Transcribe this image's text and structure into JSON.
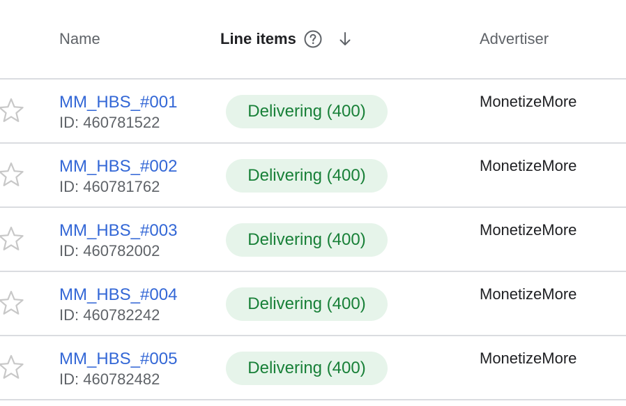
{
  "header": {
    "name_label": "Name",
    "line_items_label": "Line items",
    "advertiser_label": "Advertiser",
    "help_icon": "help-circle-icon",
    "sort_icon": "arrow-down-icon"
  },
  "colors": {
    "link": "#3367d6",
    "chip_bg": "#e6f4ea",
    "chip_text": "#188038",
    "divider": "#dadce0"
  },
  "rows": [
    {
      "name": "MM_HBS_#001",
      "id": "ID: 460781522",
      "status": "Delivering (400)",
      "advertiser": "MonetizeMore"
    },
    {
      "name": "MM_HBS_#002",
      "id": "ID: 460781762",
      "status": "Delivering (400)",
      "advertiser": "MonetizeMore"
    },
    {
      "name": "MM_HBS_#003",
      "id": "ID: 460782002",
      "status": "Delivering (400)",
      "advertiser": "MonetizeMore"
    },
    {
      "name": "MM_HBS_#004",
      "id": "ID: 460782242",
      "status": "Delivering (400)",
      "advertiser": "MonetizeMore"
    },
    {
      "name": "MM_HBS_#005",
      "id": "ID: 460782482",
      "status": "Delivering (400)",
      "advertiser": "MonetizeMore"
    }
  ]
}
